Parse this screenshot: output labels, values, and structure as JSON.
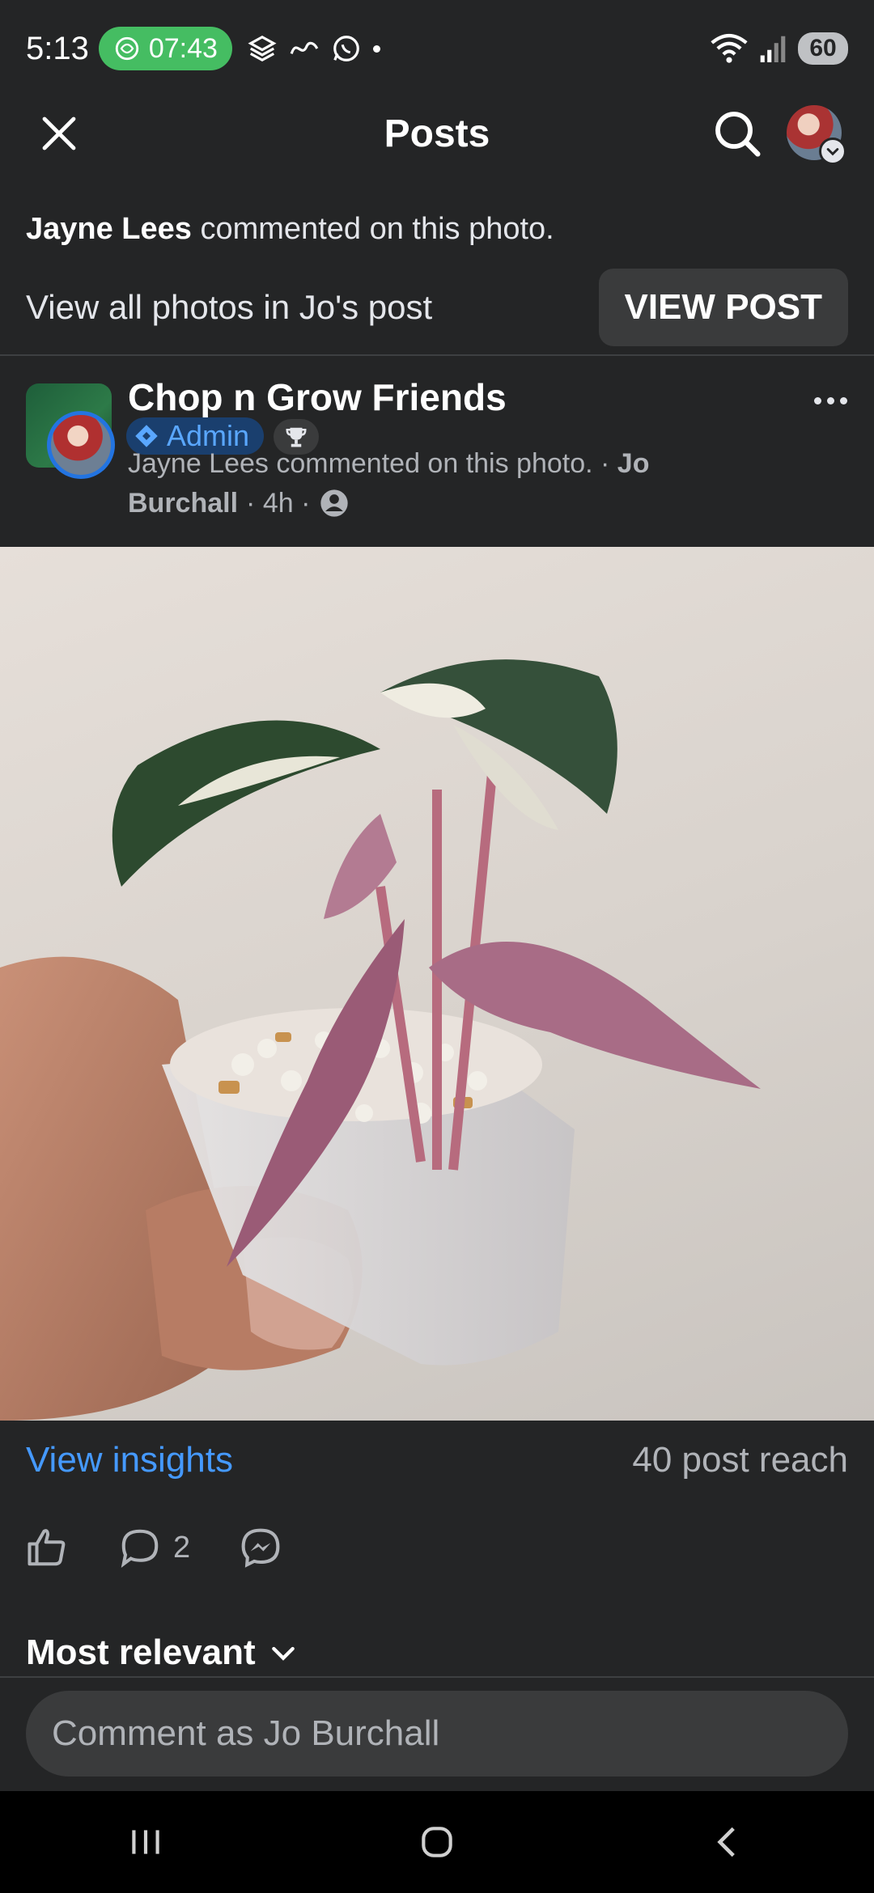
{
  "status_bar": {
    "time": "5:13",
    "pill_time": "07:43",
    "battery": "60"
  },
  "header": {
    "title": "Posts"
  },
  "notice": {
    "name": "Jayne Lees",
    "text": "commented on this photo."
  },
  "view_row": {
    "text": "View all photos in Jo's post",
    "button": "VIEW POST"
  },
  "post": {
    "group_name": "Chop n Grow Friends",
    "badge": "Admin",
    "meta_line1": "Jayne Lees commented on this photo. · ",
    "author_first": "Jo",
    "author_last": "Burchall",
    "meta_time": "· 4h ·"
  },
  "insights": {
    "link": "View insights",
    "reach": "40 post reach"
  },
  "actions": {
    "comment_count": "2"
  },
  "comments": {
    "sort_label": "Most relevant",
    "input_placeholder": "Comment as Jo Burchall"
  },
  "colors": {
    "background": "#242526",
    "accent_link": "#4599ff",
    "status_pill": "#45bd62",
    "admin_badge_bg": "#1a3f6e"
  },
  "icons": [
    "close-icon",
    "search-icon",
    "chevron-down-icon",
    "more-icon",
    "admin-diamond-icon",
    "trophy-icon",
    "group-audience-icon",
    "like-icon",
    "comment-icon",
    "messenger-icon",
    "recents-icon",
    "home-icon",
    "back-icon"
  ]
}
